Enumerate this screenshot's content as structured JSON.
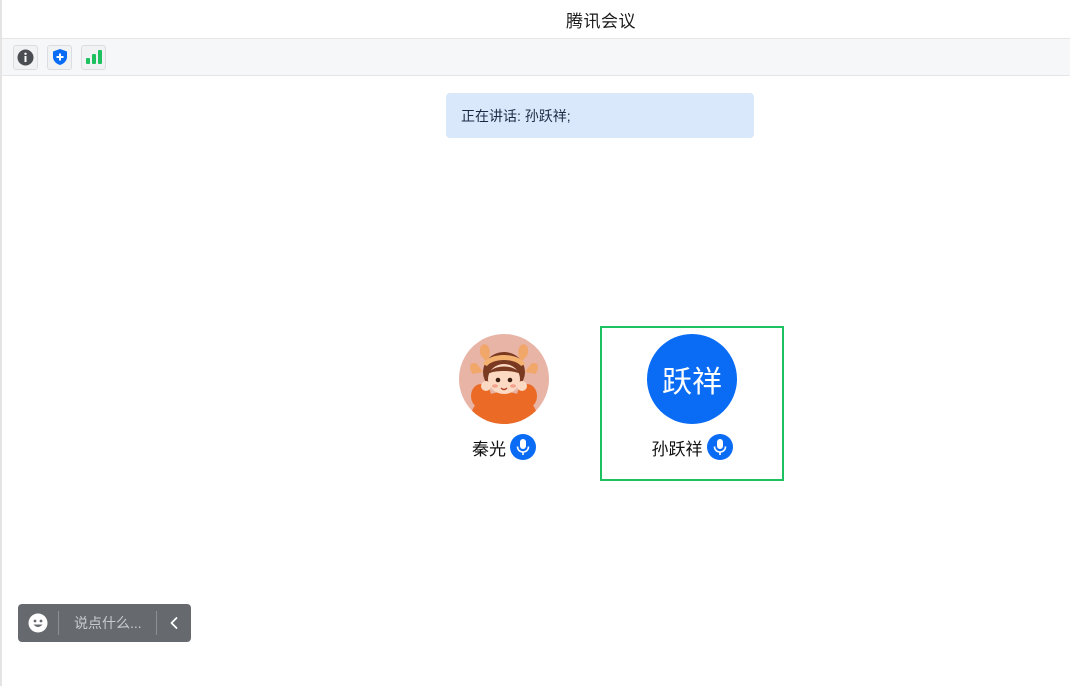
{
  "window": {
    "title": "腾讯会议"
  },
  "toolbar": {
    "buttons": [
      {
        "icon": "info-icon"
      },
      {
        "icon": "shield-plus-icon"
      },
      {
        "icon": "signal-bars-icon"
      }
    ]
  },
  "speaking": {
    "text": "正在讲话: 孙跃祥;"
  },
  "participants": [
    {
      "name": "秦光",
      "avatar": "photo",
      "mic": "mic-icon"
    },
    {
      "name": "孙跃祥",
      "avatar_text": "跃祥",
      "mic": "mic-icon",
      "active_speaker": true
    }
  ],
  "chat": {
    "placeholder": "说点什么..."
  },
  "colors": {
    "accent": "#0a6cf5",
    "active_border": "#1ec15f",
    "banner_bg": "#d9e8fb",
    "chat_bg": "#666a6e"
  }
}
